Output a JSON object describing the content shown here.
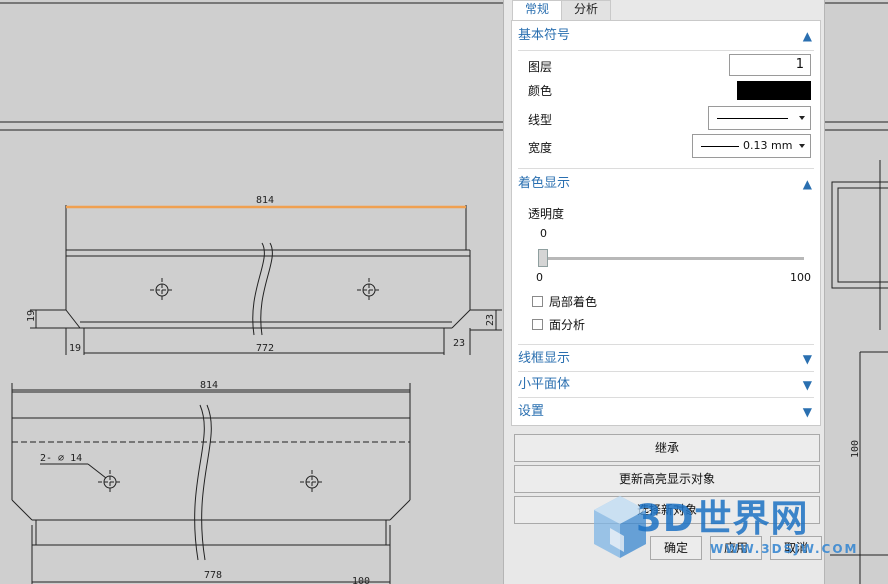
{
  "tabs": [
    {
      "label": "常规",
      "active": true
    },
    {
      "label": "分析",
      "active": false
    }
  ],
  "sections": {
    "basic": {
      "title": "基本符号",
      "layer_label": "图层",
      "layer_value": "1",
      "color_label": "颜色",
      "color_value": "#000000",
      "linetype_label": "线型",
      "width_label": "宽度",
      "width_value": "0.13 mm"
    },
    "shading": {
      "title": "着色显示",
      "transparency_label": "透明度",
      "slider_value": "0",
      "slider_min": "0",
      "slider_max": "100",
      "slider_fraction": 0,
      "partial_shading_label": "局部着色",
      "face_analysis_label": "面分析"
    },
    "wireframe": {
      "title": "线框显示"
    },
    "small_face": {
      "title": "小平面体"
    },
    "settings": {
      "title": "设置"
    }
  },
  "buttons": {
    "inherit": "继承",
    "update_highlight": "更新高亮显示对象",
    "select_new": "选择新对象",
    "ok": "确定",
    "apply": "应用",
    "cancel": "取消"
  },
  "drawing": {
    "top_overall": "814",
    "top_length": "772",
    "top_left_h": "19",
    "top_right_h": "23",
    "top_left_w": "19",
    "top_right_w": "23",
    "bot_overall": "814",
    "bot_hole": "2- ∅ 14",
    "bot_length": "778",
    "bot_partial": "100",
    "right_dim": "100",
    "highlight_color": "#f0a050"
  },
  "watermark": {
    "text": "3D世界网",
    "url": "WWW.3DSJW.COM"
  }
}
